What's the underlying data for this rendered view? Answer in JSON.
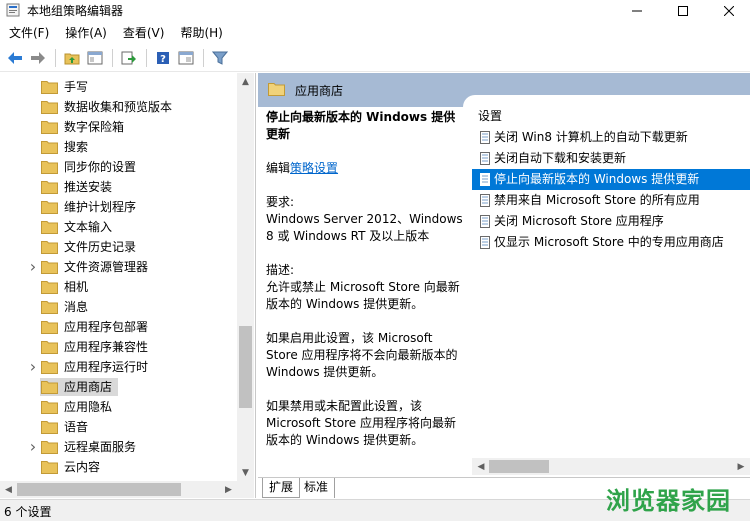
{
  "window": {
    "title": "本地组策略编辑器"
  },
  "menu": [
    "文件(F)",
    "操作(A)",
    "查看(V)",
    "帮助(H)"
  ],
  "toolbar": {
    "icons": [
      "back-icon",
      "forward-icon",
      "up-folder-icon",
      "show-tree-icon",
      "export-icon",
      "help-icon",
      "properties-icon",
      "filter-icon"
    ]
  },
  "tree": {
    "items": [
      {
        "label": "手写",
        "expandable": false,
        "selected": false
      },
      {
        "label": "数据收集和预览版本",
        "expandable": false,
        "selected": false
      },
      {
        "label": "数字保险箱",
        "expandable": false,
        "selected": false
      },
      {
        "label": "搜索",
        "expandable": false,
        "selected": false
      },
      {
        "label": "同步你的设置",
        "expandable": false,
        "selected": false
      },
      {
        "label": "推送安装",
        "expandable": false,
        "selected": false
      },
      {
        "label": "维护计划程序",
        "expandable": false,
        "selected": false
      },
      {
        "label": "文本输入",
        "expandable": false,
        "selected": false
      },
      {
        "label": "文件历史记录",
        "expandable": false,
        "selected": false
      },
      {
        "label": "文件资源管理器",
        "expandable": true,
        "selected": false
      },
      {
        "label": "相机",
        "expandable": false,
        "selected": false
      },
      {
        "label": "消息",
        "expandable": false,
        "selected": false
      },
      {
        "label": "应用程序包部署",
        "expandable": false,
        "selected": false
      },
      {
        "label": "应用程序兼容性",
        "expandable": false,
        "selected": false
      },
      {
        "label": "应用程序运行时",
        "expandable": true,
        "selected": false
      },
      {
        "label": "应用商店",
        "expandable": false,
        "selected": true
      },
      {
        "label": "应用隐私",
        "expandable": false,
        "selected": false
      },
      {
        "label": "语音",
        "expandable": false,
        "selected": false
      },
      {
        "label": "远程桌面服务",
        "expandable": true,
        "selected": false
      },
      {
        "label": "云内容",
        "expandable": false,
        "selected": false
      }
    ]
  },
  "right": {
    "header_title": "应用商店",
    "description": {
      "title": "停止向最新版本的 Windows 提供更新",
      "edit_prefix": "编辑",
      "edit_link": "策略设置",
      "requirements_label": "要求:",
      "requirements_text": "Windows Server 2012、Windows 8 或 Windows RT 及以上版本",
      "desc_label": "描述:",
      "desc_text": "允许或禁止 Microsoft Store 向最新版本的 Windows 提供更新。",
      "enabled_text": "如果启用此设置，该 Microsoft Store 应用程序将不会向最新版本的 Windows 提供更新。",
      "disabled_text": "如果禁用或未配置此设置，该 Microsoft Store 应用程序将向最新版本的 Windows 提供更新。"
    },
    "settings_header": "设置",
    "settings": [
      {
        "label": "关闭 Win8 计算机上的自动下载更新",
        "selected": false
      },
      {
        "label": "关闭自动下载和安装更新",
        "selected": false
      },
      {
        "label": "停止向最新版本的 Windows 提供更新",
        "selected": true
      },
      {
        "label": "禁用来自 Microsoft Store 的所有应用",
        "selected": false
      },
      {
        "label": "关闭 Microsoft Store 应用程序",
        "selected": false
      },
      {
        "label": "仅显示 Microsoft Store 中的专用应用商店",
        "selected": false
      }
    ],
    "tabs": [
      "扩展",
      "标准"
    ]
  },
  "status": {
    "text": "6 个设置"
  },
  "watermark": "浏览器家园",
  "colors": {
    "header_band": "#a6bad4",
    "selection": "#0078d7",
    "tree_selection": "#d9d9d9",
    "folder": "#e8c25a",
    "watermark": "#2fa34a"
  }
}
